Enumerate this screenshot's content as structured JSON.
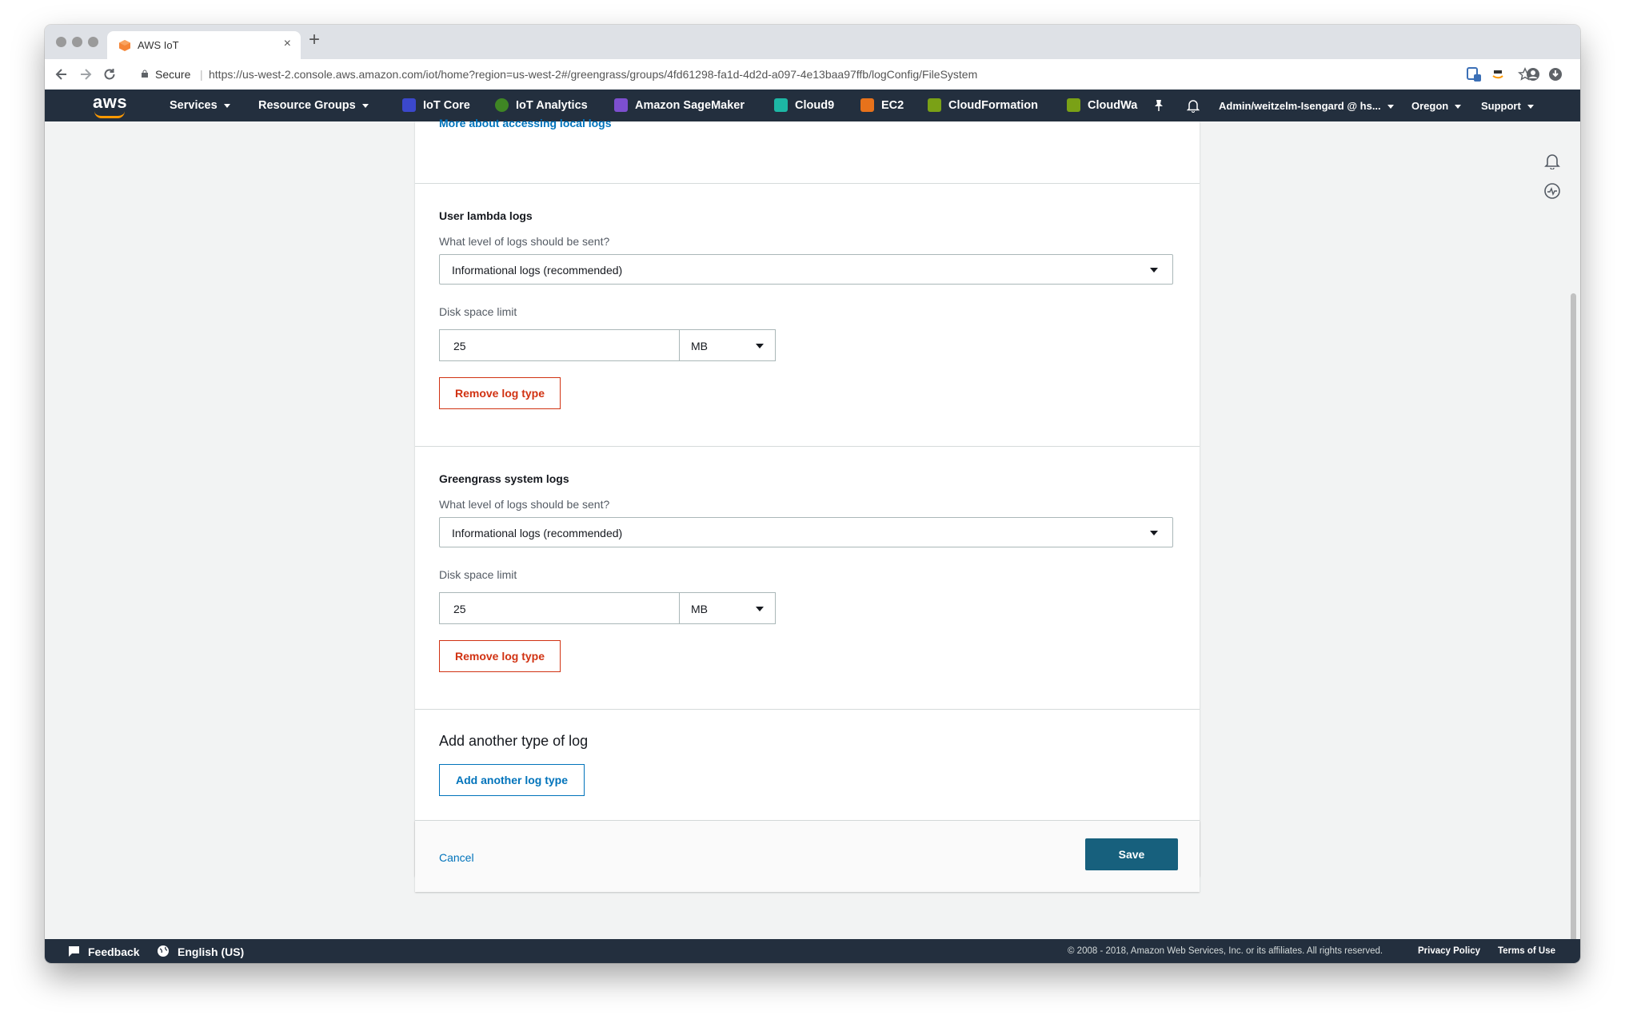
{
  "browser": {
    "tab_title": "AWS IoT",
    "close_glyph": "×",
    "new_tab_glyph": "+",
    "secure_label": "Secure",
    "url": "https://us-west-2.console.aws.amazon.com/iot/home?region=us-west-2#/greengrass/groups/4fd61298-fa1d-4d2d-a097-4e13baa97ffb/logConfig/FileSystem"
  },
  "aws_nav": {
    "logo": "aws",
    "services": "Services",
    "resource_groups": "Resource Groups",
    "pinned": [
      {
        "label": "IoT Core",
        "color": "#3b48cc"
      },
      {
        "label": "IoT Analytics",
        "color": "#3f8624"
      },
      {
        "label": "Amazon SageMaker",
        "color": "#7d4fcf"
      },
      {
        "label": "Cloud9",
        "color": "#1db7a5"
      },
      {
        "label": "EC2",
        "color": "#e7721b"
      },
      {
        "label": "CloudFormation",
        "color": "#7aa116"
      },
      {
        "label": "CloudWa",
        "color": "#7aa116"
      }
    ],
    "account": "Admin/weitzelm-Isengard @ hs...",
    "region": "Oregon",
    "support": "Support"
  },
  "page": {
    "top_link": "More about accessing local logs",
    "sections": [
      {
        "title": "User lambda logs",
        "level_label": "What level of logs should be sent?",
        "level_value": "Informational logs (recommended)",
        "disk_label": "Disk space limit",
        "disk_value": "25",
        "disk_unit": "MB",
        "remove_label": "Remove log type"
      },
      {
        "title": "Greengrass system logs",
        "level_label": "What level of logs should be sent?",
        "level_value": "Informational logs (recommended)",
        "disk_label": "Disk space limit",
        "disk_value": "25",
        "disk_unit": "MB",
        "remove_label": "Remove log type"
      }
    ],
    "add_title": "Add another type of log",
    "add_button": "Add another log type",
    "cancel": "Cancel",
    "save": "Save"
  },
  "footer": {
    "feedback": "Feedback",
    "language": "English (US)",
    "copyright": "© 2008 - 2018, Amazon Web Services, Inc. or its affiliates. All rights reserved.",
    "privacy": "Privacy Policy",
    "terms": "Terms of Use"
  },
  "colors": {
    "nav_bg": "#232f3e",
    "link": "#0073bb",
    "danger": "#d13212",
    "primary": "#17607d",
    "aws_orange": "#ff9900"
  }
}
